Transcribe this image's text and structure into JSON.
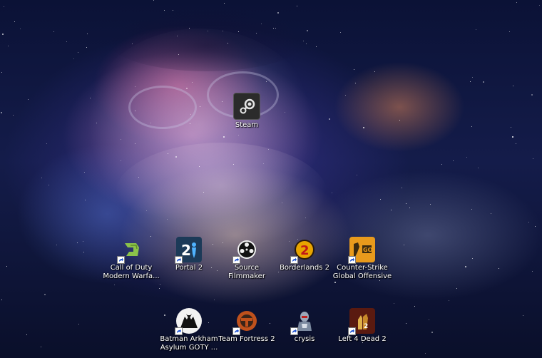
{
  "desktop": {
    "wallpaper": "galaxy-portrait-wallpaper",
    "icons": [
      {
        "name": "steam-icon",
        "label": "Steam",
        "icon": "steam-logo",
        "color": "#2a2a2a"
      },
      {
        "name": "call-of-duty-icon",
        "label": "Call of Duty\nModern Warfa...",
        "icon": "cod-logo",
        "color": "#8bc34a"
      },
      {
        "name": "portal-2-icon",
        "label": "Portal 2",
        "icon": "portal-2-logo",
        "color": "#1e3c5a"
      },
      {
        "name": "source-filmmaker-icon",
        "label": "Source\nFilmmaker",
        "icon": "film-reel",
        "color": "#111111"
      },
      {
        "name": "borderlands-2-icon",
        "label": "Borderlands 2",
        "icon": "borderlands-2-logo",
        "color": "#e0a000"
      },
      {
        "name": "counter-strike-icon",
        "label": "Counter-Strike\nGlobal Offensive",
        "icon": "csgo-logo",
        "color": "#e89a1c"
      },
      {
        "name": "batman-icon",
        "label": "Batman Arkham\nAsylum GOTY ...",
        "icon": "batman-logo",
        "color": "#f2f2f2"
      },
      {
        "name": "team-fortress-2-icon",
        "label": "Team Fortress 2",
        "icon": "tf2-logo",
        "color": "#c0511c"
      },
      {
        "name": "crysis-icon",
        "label": "crysis",
        "icon": "nanosuit",
        "color": "#9aa6b8"
      },
      {
        "name": "left-4-dead-2-icon",
        "label": "Left 4 Dead 2",
        "icon": "l4d2-logo",
        "color": "#8a2418"
      }
    ]
  }
}
